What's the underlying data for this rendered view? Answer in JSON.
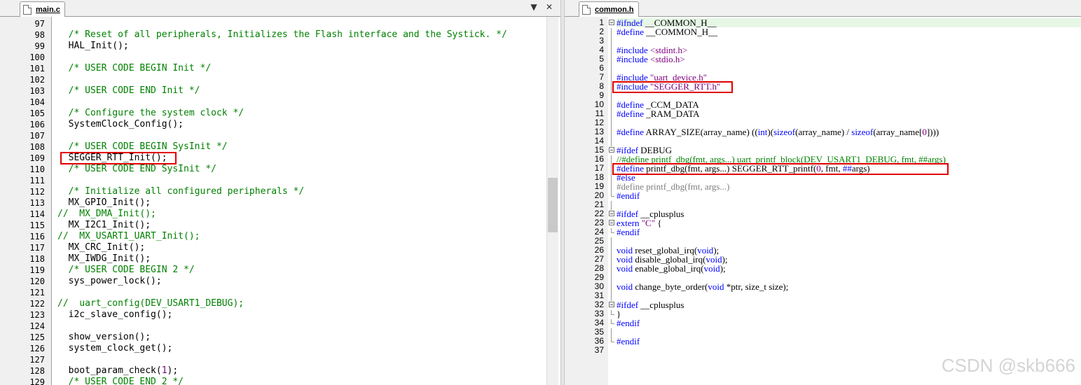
{
  "left_pane": {
    "tab_title": "main.c",
    "controls": {
      "dropdown": "▼",
      "close": "✕"
    },
    "lines": [
      {
        "n": "97",
        "segs": []
      },
      {
        "n": "98",
        "segs": [
          [
            "c",
            "  /* Reset of all peripherals, Initializes the Flash interface and the Systick. */"
          ]
        ]
      },
      {
        "n": "99",
        "segs": [
          [
            "p",
            "  HAL_Init();"
          ]
        ]
      },
      {
        "n": "100",
        "segs": []
      },
      {
        "n": "101",
        "segs": [
          [
            "c",
            "  /* USER CODE BEGIN Init */"
          ]
        ]
      },
      {
        "n": "102",
        "segs": []
      },
      {
        "n": "103",
        "segs": [
          [
            "c",
            "  /* USER CODE END Init */"
          ]
        ]
      },
      {
        "n": "104",
        "segs": []
      },
      {
        "n": "105",
        "segs": [
          [
            "c",
            "  /* Configure the system clock */"
          ]
        ]
      },
      {
        "n": "106",
        "segs": [
          [
            "p",
            "  SystemClock_Config();"
          ]
        ]
      },
      {
        "n": "107",
        "segs": []
      },
      {
        "n": "108",
        "segs": [
          [
            "c",
            "  /* USER CODE BEGIN SysInit */"
          ]
        ]
      },
      {
        "n": "109",
        "segs": [
          [
            "p",
            "  SEGGER_RTT_Init();"
          ]
        ]
      },
      {
        "n": "110",
        "segs": [
          [
            "c",
            "  /* USER CODE END SysInit */"
          ]
        ]
      },
      {
        "n": "111",
        "segs": []
      },
      {
        "n": "112",
        "segs": [
          [
            "c",
            "  /* Initialize all configured peripherals */"
          ]
        ]
      },
      {
        "n": "113",
        "segs": [
          [
            "p",
            "  MX_GPIO_Init();"
          ]
        ]
      },
      {
        "n": "114",
        "segs": [
          [
            "c",
            "//  MX_DMA_Init();"
          ]
        ]
      },
      {
        "n": "115",
        "segs": [
          [
            "p",
            "  MX_I2C1_Init();"
          ]
        ]
      },
      {
        "n": "116",
        "segs": [
          [
            "c",
            "//  MX_USART1_UART_Init();"
          ]
        ]
      },
      {
        "n": "117",
        "segs": [
          [
            "p",
            "  MX_CRC_Init();"
          ]
        ]
      },
      {
        "n": "118",
        "segs": [
          [
            "p",
            "  MX_IWDG_Init();"
          ]
        ]
      },
      {
        "n": "119",
        "segs": [
          [
            "c",
            "  /* USER CODE BEGIN 2 */"
          ]
        ]
      },
      {
        "n": "120",
        "segs": [
          [
            "p",
            "  sys_power_lock();"
          ]
        ]
      },
      {
        "n": "121",
        "segs": []
      },
      {
        "n": "122",
        "segs": [
          [
            "c",
            "//  uart_config(DEV_USART1_DEBUG);"
          ]
        ]
      },
      {
        "n": "123",
        "segs": [
          [
            "p",
            "  i2c_slave_config();"
          ]
        ]
      },
      {
        "n": "124",
        "segs": []
      },
      {
        "n": "125",
        "segs": [
          [
            "p",
            "  show_version();"
          ]
        ]
      },
      {
        "n": "126",
        "segs": [
          [
            "p",
            "  system_clock_get();"
          ]
        ]
      },
      {
        "n": "127",
        "segs": []
      },
      {
        "n": "128",
        "segs": [
          [
            "p",
            "  boot_param_check("
          ],
          [
            "num",
            "1"
          ],
          [
            "p",
            ");"
          ]
        ]
      },
      {
        "n": "129",
        "segs": [
          [
            "c",
            "  /* USER CODE END 2 */"
          ]
        ]
      }
    ]
  },
  "right_pane": {
    "tab_title": "common.h",
    "lines": [
      {
        "n": "1",
        "fold": "box",
        "segs": [
          [
            "pp",
            "#ifndef"
          ],
          [
            "p",
            " __COMMON_H__"
          ]
        ]
      },
      {
        "n": "2",
        "fold": "line",
        "segs": [
          [
            "pp",
            "#define"
          ],
          [
            "p",
            " __COMMON_H__"
          ]
        ]
      },
      {
        "n": "3",
        "fold": "line",
        "segs": []
      },
      {
        "n": "4",
        "fold": "line",
        "segs": [
          [
            "pp",
            "#include"
          ],
          [
            "p",
            " "
          ],
          [
            "str",
            "<stdint.h>"
          ]
        ]
      },
      {
        "n": "5",
        "fold": "line",
        "segs": [
          [
            "pp",
            "#include"
          ],
          [
            "p",
            " "
          ],
          [
            "str",
            "<stdio.h>"
          ]
        ]
      },
      {
        "n": "6",
        "fold": "line",
        "segs": []
      },
      {
        "n": "7",
        "fold": "line",
        "segs": [
          [
            "pp",
            "#include"
          ],
          [
            "p",
            " "
          ],
          [
            "str",
            "\"uart_device.h\""
          ]
        ]
      },
      {
        "n": "8",
        "fold": "line",
        "segs": [
          [
            "pp",
            "#include"
          ],
          [
            "p",
            " "
          ],
          [
            "str",
            "\"SEGGER_RTT.h\""
          ]
        ]
      },
      {
        "n": "9",
        "fold": "line",
        "segs": []
      },
      {
        "n": "10",
        "fold": "line",
        "segs": [
          [
            "pp",
            "#define"
          ],
          [
            "p",
            " _CCM_DATA"
          ]
        ]
      },
      {
        "n": "11",
        "fold": "line",
        "segs": [
          [
            "pp",
            "#define"
          ],
          [
            "p",
            " _RAM_DATA"
          ]
        ]
      },
      {
        "n": "12",
        "fold": "line",
        "segs": []
      },
      {
        "n": "13",
        "fold": "line",
        "segs": [
          [
            "pp",
            "#define"
          ],
          [
            "p",
            " ARRAY_SIZE(array_name) (("
          ],
          [
            "kw",
            "int"
          ],
          [
            "p",
            ")("
          ],
          [
            "kw",
            "sizeof"
          ],
          [
            "p",
            "(array_name) / "
          ],
          [
            "kw",
            "sizeof"
          ],
          [
            "p",
            "(array_name["
          ],
          [
            "num",
            "0"
          ],
          [
            "p",
            "])))"
          ]
        ]
      },
      {
        "n": "14",
        "fold": "line",
        "segs": []
      },
      {
        "n": "15",
        "fold": "box",
        "segs": [
          [
            "pp",
            "#ifdef"
          ],
          [
            "p",
            " DEBUG"
          ]
        ]
      },
      {
        "n": "16",
        "fold": "line",
        "segs": [
          [
            "c",
            "//#define printf_dbg(fmt, args...) uart_printf_block(DEV_USART1_DEBUG, fmt, ##args)"
          ]
        ]
      },
      {
        "n": "17",
        "fold": "line",
        "segs": [
          [
            "pp",
            "#define"
          ],
          [
            "p",
            " printf_dbg(fmt, args...) SEGGER_RTT_printf("
          ],
          [
            "num",
            "0"
          ],
          [
            "p",
            ", fmt, "
          ],
          [
            "kw",
            "##"
          ],
          [
            "p",
            "args)"
          ]
        ]
      },
      {
        "n": "18",
        "fold": "line",
        "segs": [
          [
            "pp",
            "#else"
          ]
        ]
      },
      {
        "n": "19",
        "fold": "line",
        "segs": [
          [
            "g",
            "#define printf_dbg(fmt, args...)"
          ]
        ]
      },
      {
        "n": "20",
        "fold": "end",
        "segs": [
          [
            "pp",
            "#endif"
          ]
        ]
      },
      {
        "n": "21",
        "fold": "line",
        "segs": []
      },
      {
        "n": "22",
        "fold": "box",
        "segs": [
          [
            "pp",
            "#ifdef"
          ],
          [
            "p",
            " __cplusplus"
          ]
        ]
      },
      {
        "n": "23",
        "fold": "box",
        "segs": [
          [
            "kw",
            "extern"
          ],
          [
            "p",
            " "
          ],
          [
            "str",
            "\"C\""
          ],
          [
            "p",
            " {"
          ]
        ]
      },
      {
        "n": "24",
        "fold": "end",
        "segs": [
          [
            "pp",
            "#endif"
          ]
        ]
      },
      {
        "n": "25",
        "fold": "line",
        "segs": []
      },
      {
        "n": "26",
        "fold": "line",
        "segs": [
          [
            "kw",
            "void"
          ],
          [
            "p",
            " reset_global_irq("
          ],
          [
            "kw",
            "void"
          ],
          [
            "p",
            ");"
          ]
        ]
      },
      {
        "n": "27",
        "fold": "line",
        "segs": [
          [
            "kw",
            "void"
          ],
          [
            "p",
            " disable_global_irq("
          ],
          [
            "kw",
            "void"
          ],
          [
            "p",
            ");"
          ]
        ]
      },
      {
        "n": "28",
        "fold": "line",
        "segs": [
          [
            "kw",
            "void"
          ],
          [
            "p",
            " enable_global_irq("
          ],
          [
            "kw",
            "void"
          ],
          [
            "p",
            ");"
          ]
        ]
      },
      {
        "n": "29",
        "fold": "line",
        "segs": []
      },
      {
        "n": "30",
        "fold": "line",
        "segs": [
          [
            "kw",
            "void"
          ],
          [
            "p",
            " change_byte_order("
          ],
          [
            "kw",
            "void"
          ],
          [
            "p",
            " *ptr, size_t size);"
          ]
        ]
      },
      {
        "n": "31",
        "fold": "line",
        "segs": []
      },
      {
        "n": "32",
        "fold": "box",
        "segs": [
          [
            "pp",
            "#ifdef"
          ],
          [
            "p",
            " __cplusplus"
          ]
        ]
      },
      {
        "n": "33",
        "fold": "end",
        "segs": [
          [
            "p",
            "}"
          ]
        ]
      },
      {
        "n": "34",
        "fold": "end",
        "segs": [
          [
            "pp",
            "#endif"
          ]
        ]
      },
      {
        "n": "35",
        "fold": "line",
        "segs": []
      },
      {
        "n": "36",
        "fold": "end",
        "segs": [
          [
            "pp",
            "#endif"
          ]
        ]
      },
      {
        "n": "37",
        "fold": "none",
        "segs": []
      }
    ]
  },
  "watermark": "CSDN @skb666",
  "colors": {
    "comment": "#008000",
    "keyword": "#0000ff",
    "string": "#800080",
    "highlight_box": "#e00000"
  }
}
